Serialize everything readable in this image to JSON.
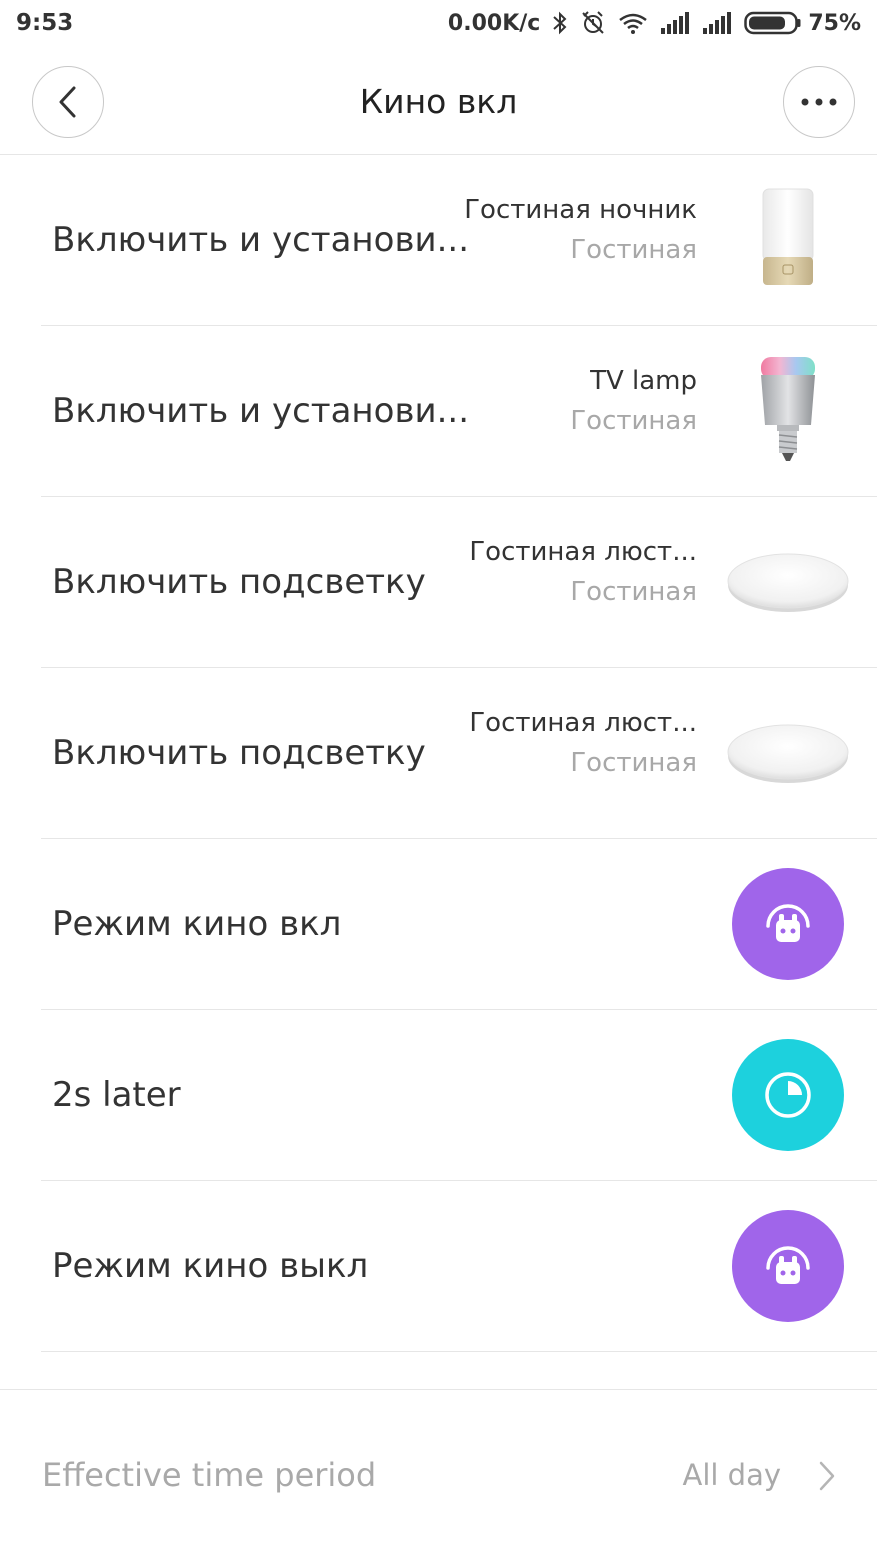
{
  "status_bar": {
    "time": "9:53",
    "net_speed": "0.00K/c",
    "battery": "75%",
    "icons": [
      "bluetooth-icon",
      "alarm-off-icon",
      "wifi-icon",
      "signal-icon",
      "signal-icon",
      "battery-icon"
    ]
  },
  "header": {
    "title": "Кино вкл",
    "back_icon": "chevron-left-icon",
    "more_icon": "more-dots-icon"
  },
  "actions": [
    {
      "label": "Включить и установи...",
      "device": "Гостиная ночник",
      "room": "Гостиная",
      "thumb": "bedside-lamp"
    },
    {
      "label": "Включить и установи...",
      "device": "TV lamp",
      "room": "Гостиная",
      "thumb": "color-bulb"
    },
    {
      "label": "Включить подсветку",
      "device": "Гостиная люст...",
      "room": "Гостиная",
      "thumb": "ceiling-light"
    },
    {
      "label": "Включить подсветку",
      "device": "Гостиная люст...",
      "room": "Гостиная",
      "thumb": "ceiling-light"
    },
    {
      "label": "Режим кино вкл",
      "icon": "robot-icon",
      "color": "#A065EA"
    },
    {
      "label": "2s later",
      "icon": "timer-icon",
      "color": "#1DD1DD"
    },
    {
      "label": "Режим кино выкл",
      "icon": "robot-icon",
      "color": "#A065EA"
    }
  ],
  "effective_period": {
    "label": "Effective time period",
    "value": "All day"
  }
}
